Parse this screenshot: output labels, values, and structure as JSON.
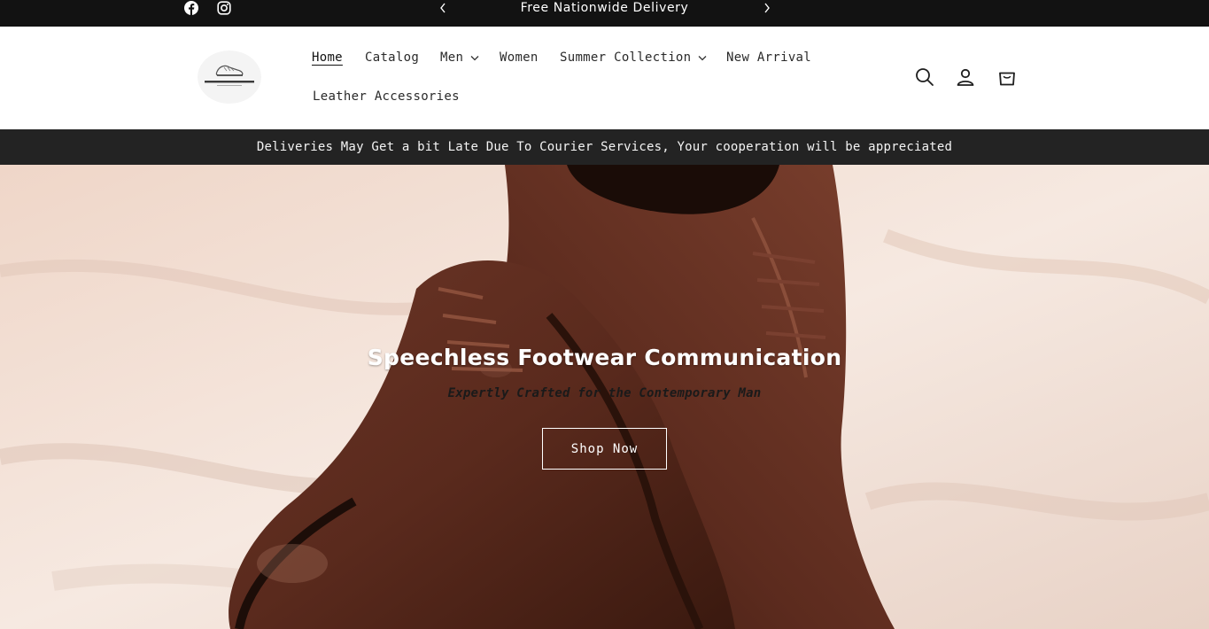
{
  "social": {
    "facebook": "facebook-icon",
    "instagram": "instagram-icon"
  },
  "announcement": {
    "text": "Free Nationwide Delivery"
  },
  "header": {
    "logo_alt": "MONARCH STEP",
    "nav": [
      {
        "label": "Home",
        "active": true
      },
      {
        "label": "Catalog"
      },
      {
        "label": "Men",
        "dropdown": true
      },
      {
        "label": "Women"
      },
      {
        "label": "Summer Collection",
        "dropdown": true
      },
      {
        "label": "New Arrival"
      },
      {
        "label": "Leather Accessories"
      }
    ],
    "icons": [
      "search-icon",
      "account-icon",
      "cart-icon"
    ]
  },
  "notice": {
    "text": "Deliveries May Get a bit Late Due To Courier Services, Your cooperation will be appreciated"
  },
  "hero": {
    "title": "Speechless Footwear Communication",
    "subtitle": "Expertly Crafted for the Contemporary Man",
    "button": "Shop Now"
  },
  "colors": {
    "topbar": "#121212",
    "notice": "#232323",
    "hero_bg": "#f1dfd3",
    "shoe": "#5a2a1d"
  }
}
